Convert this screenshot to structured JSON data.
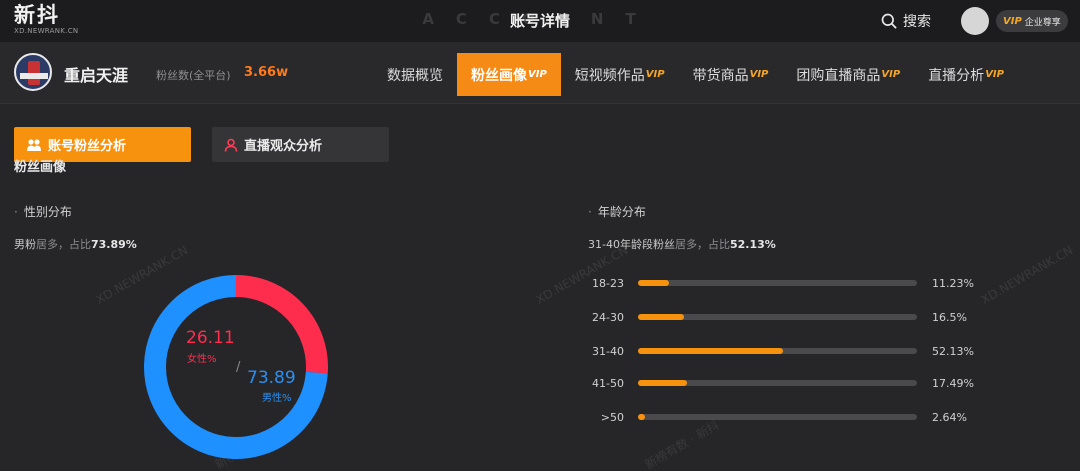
{
  "header": {
    "logo_text": "新抖",
    "logo_sub": "XD.NEWRANK.CN",
    "ghost_title": "ACCOUNT",
    "title": "账号详情",
    "search_label": "搜索",
    "vip_tag": "VIP",
    "vip_text": "企业尊享"
  },
  "account": {
    "name": "重启天涯",
    "fans_label": "粉丝数(全平台)",
    "fans_value": "3.66w"
  },
  "nav": {
    "items": [
      {
        "label": "数据概览",
        "vip": ""
      },
      {
        "label": "粉丝画像",
        "vip": "VIP"
      },
      {
        "label": "短视频作品",
        "vip": "VIP"
      },
      {
        "label": "带货商品",
        "vip": "VIP"
      },
      {
        "label": "团购直播商品",
        "vip": "VIP"
      },
      {
        "label": "直播分析",
        "vip": "VIP"
      }
    ],
    "active_index": 1
  },
  "subtabs": {
    "account_fans": "账号粉丝分析",
    "live_audience": "直播观众分析"
  },
  "section_title": "粉丝画像",
  "gender": {
    "heading": "性别分布",
    "summary_prefix": "男粉",
    "summary_mid": "居多，占比",
    "summary_value": "73.89%",
    "female_value": "26.11",
    "female_label": "女性%",
    "male_value": "73.89",
    "male_label": "男性%",
    "slash": "/",
    "colors": {
      "female": "#ff2d4d",
      "male": "#1e90ff"
    }
  },
  "age": {
    "heading": "年龄分布",
    "summary_prefix": "31-40年龄段粉丝",
    "summary_mid": "居多，占比",
    "summary_value": "52.13%",
    "rows": [
      {
        "label": "18-23",
        "value": 11.23,
        "pct": "11.23%"
      },
      {
        "label": "24-30",
        "value": 16.5,
        "pct": "16.5%"
      },
      {
        "label": "31-40",
        "value": 52.13,
        "pct": "52.13%"
      },
      {
        "label": "41-50",
        "value": 17.49,
        "pct": "17.49%"
      },
      {
        "label": ">50",
        "value": 2.64,
        "pct": "2.64%"
      }
    ]
  },
  "watermark": "XD.NEWRANK.CN",
  "watermark_bottom": "新榜有数 · 新抖"
}
